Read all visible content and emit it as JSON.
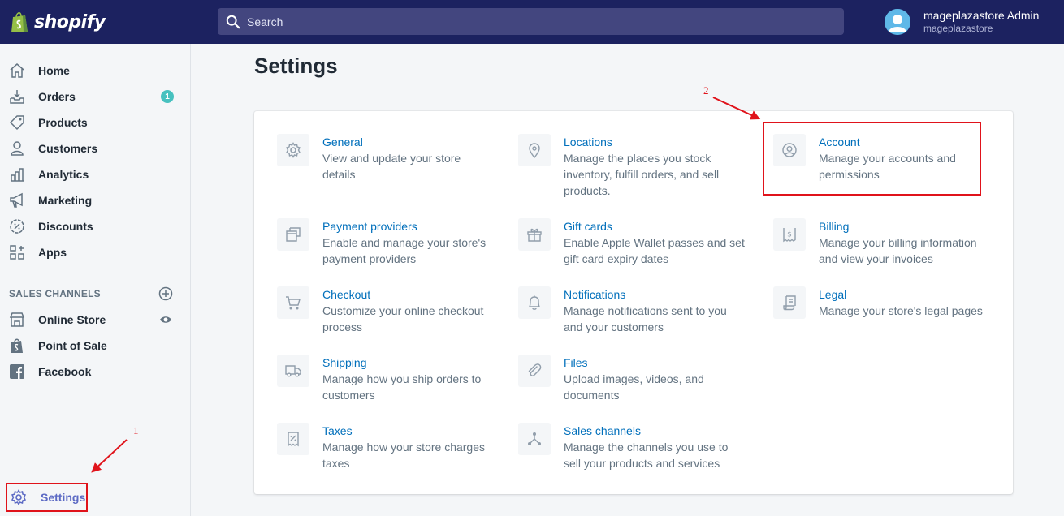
{
  "brand": {
    "name": "shopify"
  },
  "search": {
    "placeholder": "Search"
  },
  "user": {
    "name": "mageplazastore Admin",
    "store": "mageplazastore"
  },
  "sidebar": {
    "items": [
      {
        "label": "Home",
        "icon": "home-icon"
      },
      {
        "label": "Orders",
        "icon": "orders-icon",
        "badge": "1"
      },
      {
        "label": "Products",
        "icon": "tag-icon"
      },
      {
        "label": "Customers",
        "icon": "person-icon"
      },
      {
        "label": "Analytics",
        "icon": "bar-chart-icon"
      },
      {
        "label": "Marketing",
        "icon": "megaphone-icon"
      },
      {
        "label": "Discounts",
        "icon": "discount-icon"
      },
      {
        "label": "Apps",
        "icon": "apps-icon"
      }
    ],
    "channels_heading": "SALES CHANNELS",
    "channels": [
      {
        "label": "Online Store",
        "icon": "store-icon"
      },
      {
        "label": "Point of Sale",
        "icon": "pos-bag-icon"
      },
      {
        "label": "Facebook",
        "icon": "facebook-icon"
      }
    ],
    "settings_label": "Settings"
  },
  "main": {
    "title": "Settings",
    "settings": [
      {
        "title": "General",
        "desc": [
          "View and update your store",
          "details"
        ],
        "icon": "gear-icon"
      },
      {
        "title": "Locations",
        "desc": [
          "Manage the places you stock",
          "inventory, fulfill orders, and sell",
          "products."
        ],
        "icon": "location-pin-icon"
      },
      {
        "title": "Account",
        "desc": [
          "Manage your accounts and",
          "permissions"
        ],
        "icon": "account-icon"
      },
      {
        "title": "Payment providers",
        "desc": [
          "Enable and manage your store's",
          "payment providers"
        ],
        "icon": "payment-icon"
      },
      {
        "title": "Gift cards",
        "desc": [
          "Enable Apple Wallet passes and set",
          "gift card expiry dates"
        ],
        "icon": "gift-icon"
      },
      {
        "title": "Billing",
        "desc": [
          "Manage your billing information",
          "and view your invoices"
        ],
        "icon": "billing-icon"
      },
      {
        "title": "Checkout",
        "desc": [
          "Customize your online checkout",
          "process"
        ],
        "icon": "cart-icon"
      },
      {
        "title": "Notifications",
        "desc": [
          "Manage notifications sent to you",
          "and your customers"
        ],
        "icon": "bell-icon"
      },
      {
        "title": "Legal",
        "desc": [
          "Manage your store's legal pages"
        ],
        "icon": "legal-scroll-icon"
      },
      {
        "title": "Shipping",
        "desc": [
          "Manage how you ship orders to",
          "customers"
        ],
        "icon": "truck-icon"
      },
      {
        "title": "Files",
        "desc": [
          "Upload images, videos, and",
          "documents"
        ],
        "icon": "paperclip-icon"
      },
      {
        "title": "Taxes",
        "desc": [
          "Manage how your store charges",
          "taxes"
        ],
        "icon": "tax-receipt-icon"
      },
      {
        "title": "Sales channels",
        "desc": [
          "Manage the channels you use to",
          "sell your products and services"
        ],
        "icon": "channels-icon"
      }
    ]
  },
  "annotations": {
    "step1": "1",
    "step2": "2"
  },
  "colors": {
    "topbar": "#1c2260",
    "link": "#006fbb",
    "highlight": "#e0131b",
    "active_nav": "#5c6ac4"
  }
}
